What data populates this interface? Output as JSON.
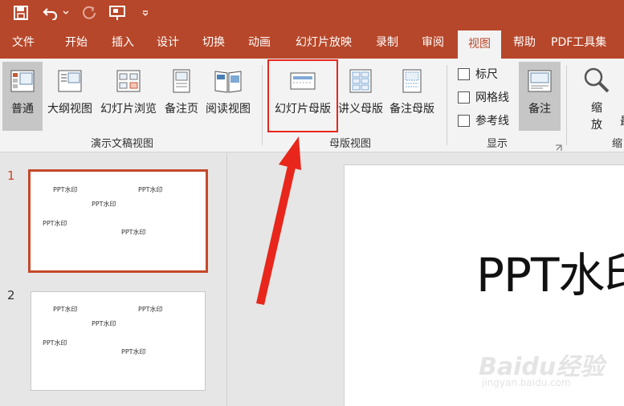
{
  "quick_access": {
    "save_icon": "save-icon",
    "undo_icon": "undo-icon",
    "redo_icon": "redo-icon",
    "present_icon": "slideshow-icon",
    "customize_icon": "customize-icon"
  },
  "colors": {
    "titlebar": "#b7472a",
    "highlight": "#e8261b",
    "arrow": "#e8261b"
  },
  "tabs": [
    {
      "label": "文件",
      "active": false
    },
    {
      "label": "开始",
      "active": false
    },
    {
      "label": "插入",
      "active": false
    },
    {
      "label": "设计",
      "active": false
    },
    {
      "label": "切换",
      "active": false
    },
    {
      "label": "动画",
      "active": false
    },
    {
      "label": "幻灯片放映",
      "active": false
    },
    {
      "label": "录制",
      "active": false
    },
    {
      "label": "审阅",
      "active": false
    },
    {
      "label": "视图",
      "active": true
    },
    {
      "label": "帮助",
      "active": false
    },
    {
      "label": "PDF工具集",
      "active": false
    }
  ],
  "ribbon": {
    "views": {
      "group_label": "演示文稿视图",
      "normal": "普通",
      "outline": "大纲视图",
      "sorter": "幻灯片浏览",
      "notes_page": "备注页",
      "reading": "阅读视图"
    },
    "master": {
      "group_label": "母版视图",
      "slide_master": "幻灯片母版",
      "handout_master": "讲义母版",
      "notes_master": "备注母版"
    },
    "show": {
      "group_label": "显示",
      "ruler": "标尺",
      "gridlines": "网格线",
      "guides": "参考线",
      "notes": "备注"
    },
    "zoom": {
      "label_line1": "缩",
      "label_line2": "放",
      "group_label_partial": "缩",
      "next_partial": "最"
    }
  },
  "slides": [
    {
      "number": "1",
      "watermarks": [
        "PPT水印",
        "PPT水印",
        "PPT水印",
        "PPT水印",
        "PPT水印"
      ]
    },
    {
      "number": "2",
      "watermarks": [
        "PPT水印",
        "PPT水印",
        "PPT水印",
        "PPT水印",
        "PPT水印"
      ]
    }
  ],
  "main_slide": {
    "text": "PPT水印"
  },
  "watermark_logo": {
    "line1": "Baidu经验",
    "line2": "jingyan.baidu.com"
  }
}
